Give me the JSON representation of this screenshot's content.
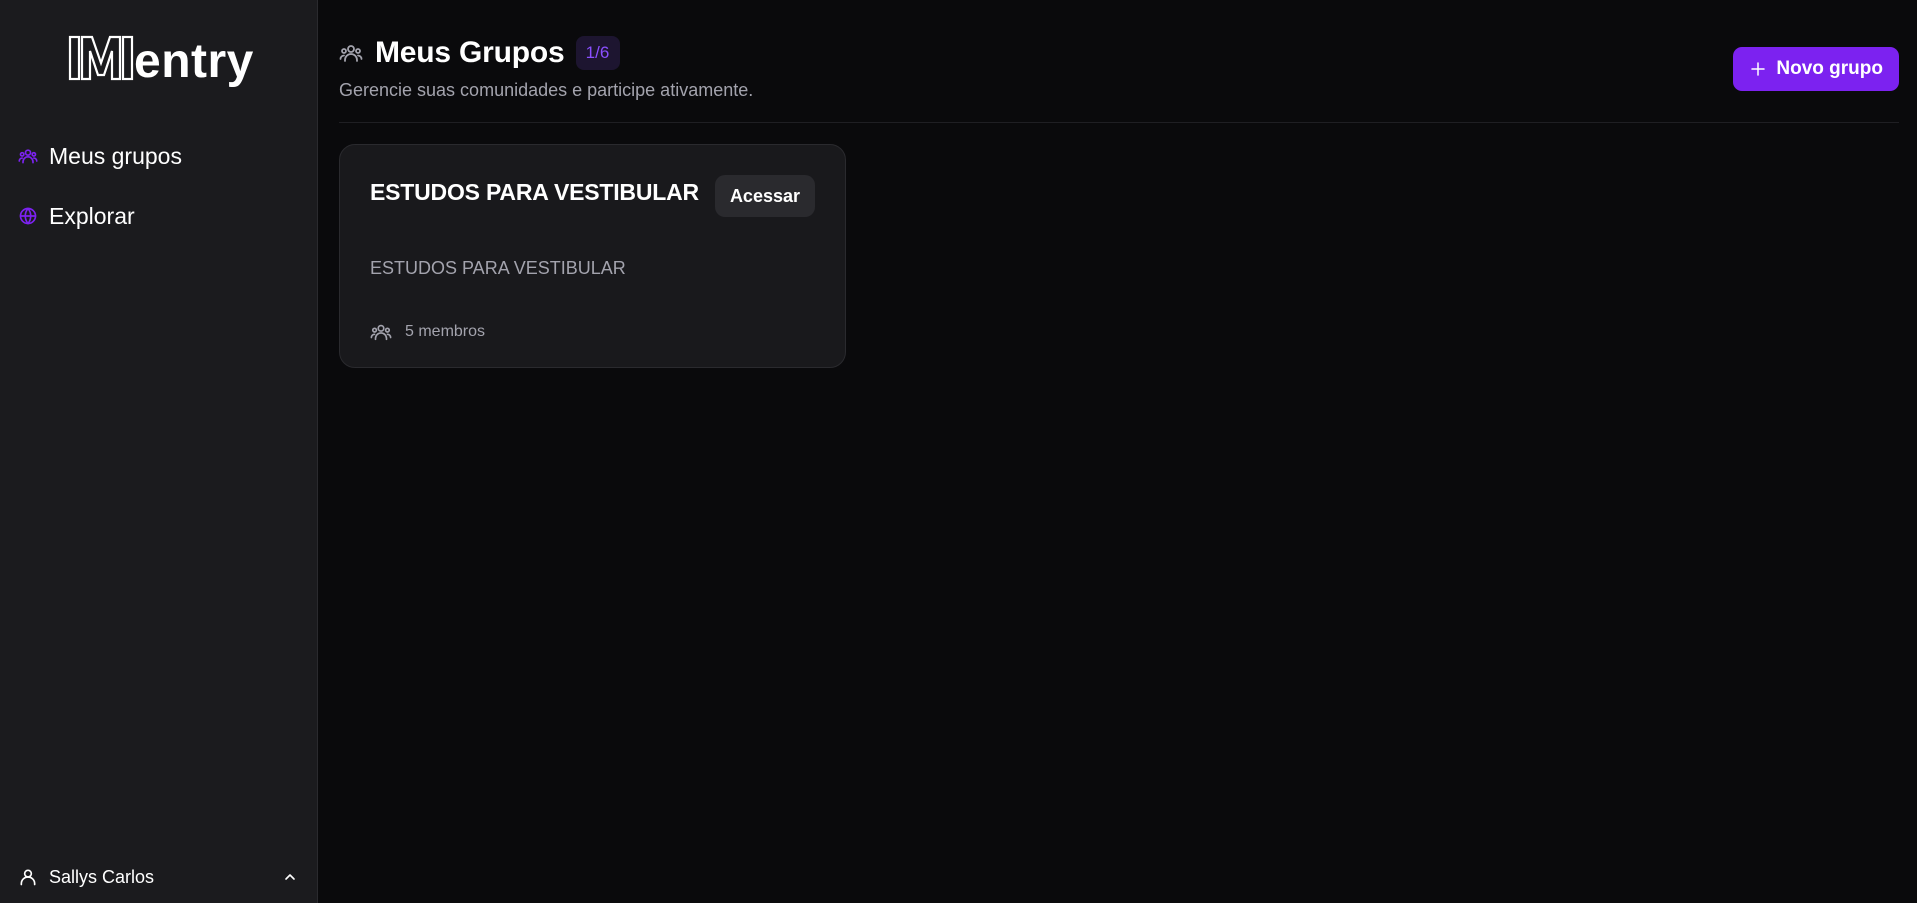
{
  "app": {
    "logo_text": "entry",
    "logo_letter": "M",
    "accent_color": "#7c22f0"
  },
  "sidebar": {
    "items": [
      {
        "label": "Meus grupos",
        "icon": "users-icon"
      },
      {
        "label": "Explorar",
        "icon": "globe-icon"
      }
    ],
    "user": {
      "name": "Sallys Carlos",
      "icon": "user-icon",
      "toggle_icon": "chevron-up-icon"
    }
  },
  "header": {
    "title": "Meus Grupos",
    "title_icon": "users-icon",
    "badge": "1/6",
    "subtitle": "Gerencie suas comunidades e participe ativamente.",
    "new_group_label": "Novo grupo",
    "new_group_icon": "plus-icon"
  },
  "groups": [
    {
      "title": "ESTUDOS PARA VESTIBULAR",
      "action_label": "Acessar",
      "description": "ESTUDOS PARA VESTIBULAR",
      "members_label": "5 membros",
      "members_icon": "users-icon"
    }
  ]
}
